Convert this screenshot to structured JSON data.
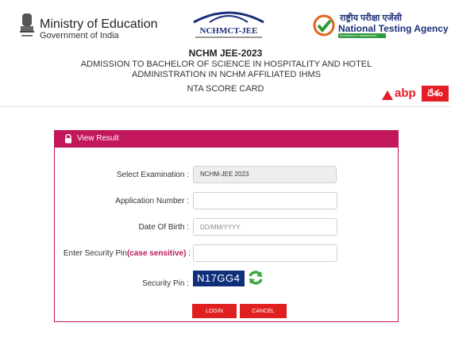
{
  "header": {
    "moe_title": "Ministry of Education",
    "moe_subtitle": "Government of India",
    "nchm_logo_text": "NCHMCT-JEE",
    "nta_hindi": "राष्ट्रीय परीक्षा एजेंसी",
    "nta_english": "National Testing Agency",
    "nta_tagline": "Excellence in Assessment"
  },
  "titles": {
    "exam": "NCHM JEE-2023",
    "admission": "ADMISSION TO BACHELOR OF SCIENCE IN HOSPITALITY AND HOTEL ADMINISTRATION IN NCHM AFFILIATED IHMS",
    "scorecard": "NTA SCORE CARD"
  },
  "watermark": {
    "abp": "abp",
    "desam": "దేశం"
  },
  "panel": {
    "title": "View Result",
    "select_exam_label": "Select Examination :",
    "select_exam_value": "NCHM-JEE 2023",
    "app_number_label": "Application Number :",
    "app_number_value": "",
    "dob_label": "Date Of Birth :",
    "dob_placeholder": "DD/MM/YYYY",
    "security_label_prefix": "Enter Security Pin",
    "security_label_highlight": "(case sensitive)",
    "security_label_suffix": " :",
    "security_value": "",
    "captcha_label": "Security Pin :",
    "captcha_value": "N17GG4",
    "login_label": "LOGIN",
    "cancel_label": "CANCEL"
  },
  "colors": {
    "accent": "#c2185b",
    "button": "#e02020",
    "captcha_bg": "#102f7a",
    "nta_blue": "#1c2f7a"
  }
}
